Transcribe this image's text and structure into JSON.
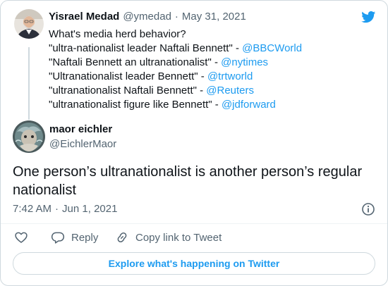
{
  "parent_tweet": {
    "author_name": "Yisrael Medad",
    "handle": "@ymedad",
    "separator": "·",
    "date": "May 31, 2021",
    "lines": [
      {
        "text": "What's media herd behavior?",
        "link": ""
      },
      {
        "text": "\"ultra-nationalist leader Naftali Bennett\" - ",
        "link": "@BBCWorld"
      },
      {
        "text": "\"Naftali Bennett an ultranationalist\" - ",
        "link": "@nytimes"
      },
      {
        "text": "\"Ultranationalist leader Bennett\" - ",
        "link": "@trtworld"
      },
      {
        "text": "\"ultranationalist Naftali Bennett\" - ",
        "link": "@Reuters"
      },
      {
        "text": "\"ultranationalist figure like Bennett\" - ",
        "link": "@jdforward"
      }
    ]
  },
  "reply_tweet": {
    "author_name": "maor eichler",
    "handle": "@EichlerMaor",
    "text": "One person’s ultranationalist is another person’s regular nationalist",
    "time": "7:42 AM",
    "separator": "·",
    "date": "Jun 1, 2021"
  },
  "actions": {
    "reply_label": "Reply",
    "copy_label": "Copy link to Tweet"
  },
  "explore_label": "Explore what's happening on Twitter",
  "icons": {
    "brand": "twitter-bird-icon",
    "info": "info-icon",
    "like": "heart-icon",
    "reply": "reply-bubble-icon",
    "copy": "link-icon"
  },
  "colors": {
    "accent": "#1d9bf0",
    "text": "#0f1419",
    "muted": "#536471",
    "border": "#cfd9de"
  }
}
